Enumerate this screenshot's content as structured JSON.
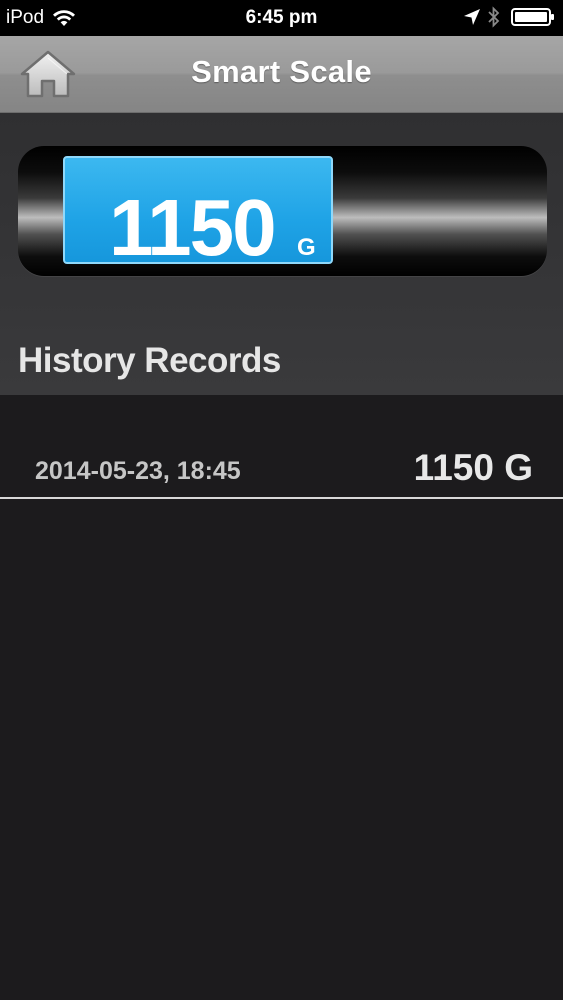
{
  "status_bar": {
    "carrier": "iPod",
    "time": "6:45 pm",
    "icons": [
      "wifi-icon",
      "location-icon",
      "bluetooth-icon",
      "battery-icon"
    ]
  },
  "nav_bar": {
    "title": "Smart Scale",
    "home_icon": "home-icon"
  },
  "scale": {
    "value": "1150",
    "unit": "G"
  },
  "history": {
    "heading": "History Records",
    "records": [
      {
        "date": "2014-05-23, 18:45",
        "weight": "1150 G"
      }
    ]
  },
  "colors": {
    "display_blue": "#1fa3e6",
    "nav_gray": "#9a9a9a",
    "background": "#1c1b1d"
  }
}
